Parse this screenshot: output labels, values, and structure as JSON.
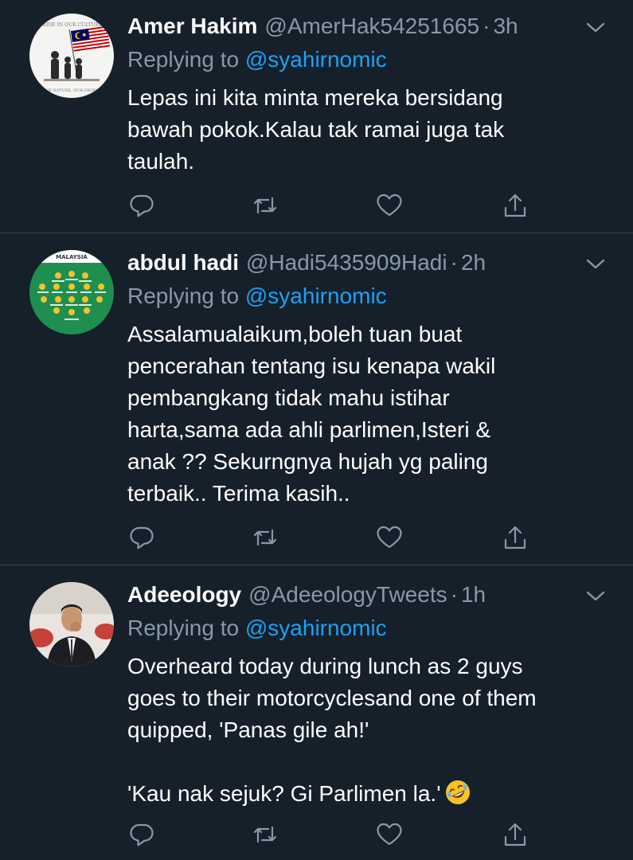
{
  "tweets": [
    {
      "name": "Amer Hakim",
      "handle": "@AmerHak54251665",
      "separator": "·",
      "time": "3h",
      "replying_prefix": "Replying to",
      "replying_to": "@syahirnomic",
      "text_lines": [
        "Lepas ini kita minta mereka bersidang",
        "bawah pokok.Kalau tak ramai juga tak",
        "taulah."
      ],
      "avatar_text_top": "PRIDE IN OUR CULTURE,",
      "avatar_text_bottom": "OUR NATURE, OUR PEOPLE"
    },
    {
      "name": "abdul hadi",
      "handle": "@Hadi5435909Hadi",
      "separator": "·",
      "time": "2h",
      "replying_prefix": "Replying to",
      "replying_to": "@syahirnomic",
      "text_lines": [
        "Assalamualaikum,boleh tuan buat",
        "pencerahan tentang isu kenapa wakil",
        "pembangkang tidak mahu istihar",
        "harta,sama ada ahli parlimen,Isteri &",
        "anak ?? Sekurngnya hujah yg paling",
        "terbaik.. Terima kasih.."
      ],
      "avatar_text_top": "MALAYSIA"
    },
    {
      "name": "Adeeology",
      "handle": "@AdeeologyTweets",
      "separator": "·",
      "time": "1h",
      "replying_prefix": "Replying to",
      "replying_to": "@syahirnomic",
      "text_lines": [
        "Overheard today during lunch as 2 guys",
        "goes to their motorcyclesand one of them",
        "quipped, 'Panas gile ah!'"
      ],
      "text_last": "'Kau nak sejuk? Gi Parlimen la.'"
    }
  ],
  "icons": {
    "reply": "reply-icon",
    "retweet": "retweet-icon",
    "like": "like-icon",
    "share": "share-icon",
    "menu": "chevron-down-icon",
    "emoji": "rolling-on-floor-laughing-emoji"
  },
  "colors": {
    "background": "#15202b",
    "text": "#ffffff",
    "muted": "#8899a6",
    "link": "#1da1f2",
    "divider": "#38444d"
  }
}
